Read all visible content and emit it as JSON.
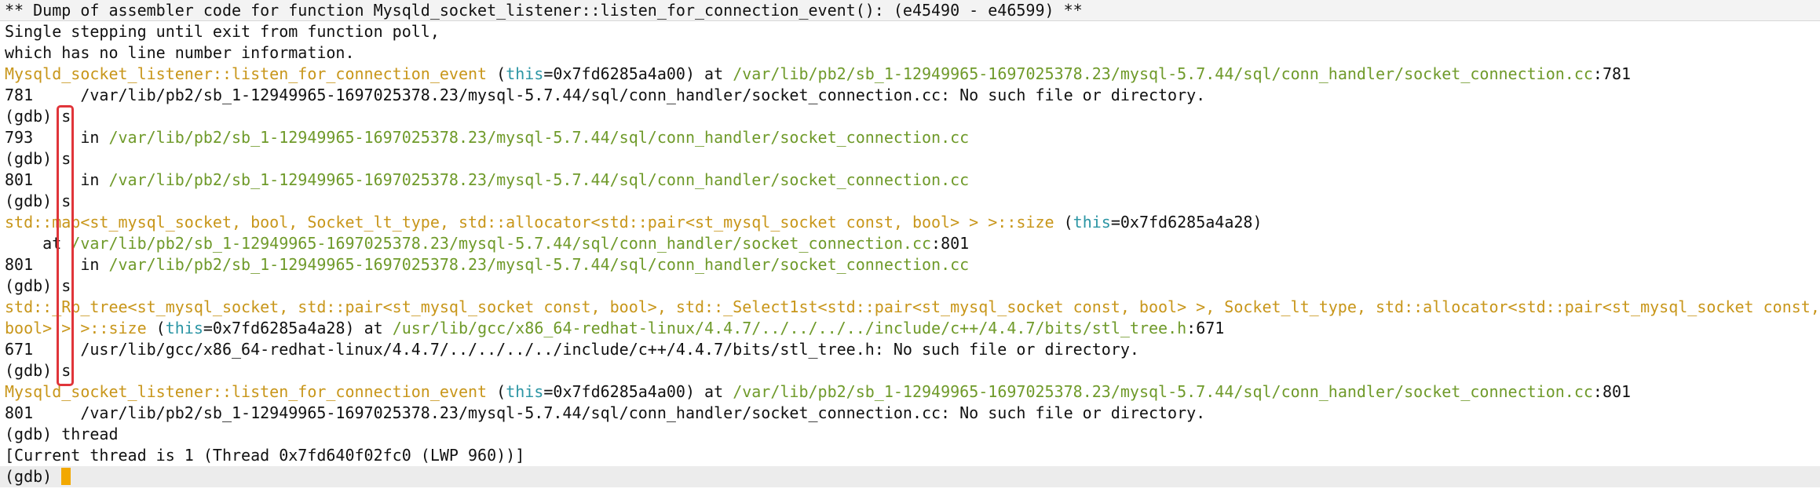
{
  "terminal": {
    "lines": [
      {
        "style": "header",
        "segments": [
          {
            "t": "** Dump of assembler code for function Mysqld_socket_listener::listen_for_connection_event(): (e45490 - e46599) **",
            "c": ""
          }
        ]
      },
      {
        "segments": [
          {
            "t": "Single stepping until exit from function poll,",
            "c": ""
          }
        ]
      },
      {
        "segments": [
          {
            "t": "which has no line number information.",
            "c": ""
          }
        ]
      },
      {
        "segments": [
          {
            "t": "Mysqld_socket_listener::listen_for_connection_event",
            "c": "fn"
          },
          {
            "t": " (",
            "c": ""
          },
          {
            "t": "this",
            "c": "kw"
          },
          {
            "t": "=0x7fd6285a4a00) at ",
            "c": ""
          },
          {
            "t": "/var/lib/pb2/sb_1-12949965-1697025378.23/mysql-5.7.44/sql/conn_handler/socket_connection.cc",
            "c": "path"
          },
          {
            "t": ":781",
            "c": ""
          }
        ]
      },
      {
        "segments": [
          {
            "t": "781     /var/lib/pb2/sb_1-12949965-1697025378.23/mysql-5.7.44/sql/conn_handler/socket_connection.cc: No such file or directory.",
            "c": ""
          }
        ]
      },
      {
        "segments": [
          {
            "t": "(gdb) s",
            "c": ""
          }
        ]
      },
      {
        "segments": [
          {
            "t": "793     in ",
            "c": ""
          },
          {
            "t": "/var/lib/pb2/sb_1-12949965-1697025378.23/mysql-5.7.44/sql/conn_handler/socket_connection.cc",
            "c": "path"
          }
        ]
      },
      {
        "segments": [
          {
            "t": "(gdb) s",
            "c": ""
          }
        ]
      },
      {
        "segments": [
          {
            "t": "801     in ",
            "c": ""
          },
          {
            "t": "/var/lib/pb2/sb_1-12949965-1697025378.23/mysql-5.7.44/sql/conn_handler/socket_connection.cc",
            "c": "path"
          }
        ]
      },
      {
        "segments": [
          {
            "t": "(gdb) s",
            "c": ""
          }
        ]
      },
      {
        "segments": [
          {
            "t": "std::map<st_mysql_socket, bool, Socket_lt_type, std::allocator<std::pair<st_mysql_socket const, bool> > >::size",
            "c": "fn"
          },
          {
            "t": " (",
            "c": ""
          },
          {
            "t": "this",
            "c": "kw"
          },
          {
            "t": "=0x7fd6285a4a28)",
            "c": ""
          }
        ]
      },
      {
        "segments": [
          {
            "t": "    at ",
            "c": ""
          },
          {
            "t": "/var/lib/pb2/sb_1-12949965-1697025378.23/mysql-5.7.44/sql/conn_handler/socket_connection.cc",
            "c": "path"
          },
          {
            "t": ":801",
            "c": ""
          }
        ]
      },
      {
        "segments": [
          {
            "t": "801     in ",
            "c": ""
          },
          {
            "t": "/var/lib/pb2/sb_1-12949965-1697025378.23/mysql-5.7.44/sql/conn_handler/socket_connection.cc",
            "c": "path"
          }
        ]
      },
      {
        "segments": [
          {
            "t": "(gdb) s",
            "c": ""
          }
        ]
      },
      {
        "segments": [
          {
            "t": "std::_Rb_tree<st_mysql_socket, std::pair<st_mysql_socket const, bool>, std::_Select1st<std::pair<st_mysql_socket const, bool> >, Socket_lt_type, std::allocator<std::pair<st_mysql_socket const,",
            "c": "fn"
          }
        ]
      },
      {
        "segments": [
          {
            "t": "bool> > >::size",
            "c": "fn"
          },
          {
            "t": " (",
            "c": ""
          },
          {
            "t": "this",
            "c": "kw"
          },
          {
            "t": "=0x7fd6285a4a28) at ",
            "c": ""
          },
          {
            "t": "/usr/lib/gcc/x86_64-redhat-linux/4.4.7/../../../../include/c++/4.4.7/bits/stl_tree.h",
            "c": "path"
          },
          {
            "t": ":671",
            "c": ""
          }
        ]
      },
      {
        "segments": [
          {
            "t": "671     /usr/lib/gcc/x86_64-redhat-linux/4.4.7/../../../../include/c++/4.4.7/bits/stl_tree.h: No such file or directory.",
            "c": ""
          }
        ]
      },
      {
        "segments": [
          {
            "t": "(gdb) s",
            "c": ""
          }
        ]
      },
      {
        "segments": [
          {
            "t": "Mysqld_socket_listener::listen_for_connection_event",
            "c": "fn"
          },
          {
            "t": " (",
            "c": ""
          },
          {
            "t": "this",
            "c": "kw"
          },
          {
            "t": "=0x7fd6285a4a00) at ",
            "c": ""
          },
          {
            "t": "/var/lib/pb2/sb_1-12949965-1697025378.23/mysql-5.7.44/sql/conn_handler/socket_connection.cc",
            "c": "path"
          },
          {
            "t": ":801",
            "c": ""
          }
        ]
      },
      {
        "segments": [
          {
            "t": "801     /var/lib/pb2/sb_1-12949965-1697025378.23/mysql-5.7.44/sql/conn_handler/socket_connection.cc: No such file or directory.",
            "c": ""
          }
        ]
      },
      {
        "segments": [
          {
            "t": "(gdb) thread",
            "c": ""
          }
        ]
      },
      {
        "segments": [
          {
            "t": "[Current thread is 1 (Thread 0x7fd640f02fc0 (LWP 960))]",
            "c": ""
          }
        ]
      },
      {
        "style": "current",
        "segments": [
          {
            "t": "(gdb) ",
            "c": ""
          }
        ],
        "cursor": true
      }
    ]
  },
  "colors": {
    "function_name": "#c8961a",
    "path": "#6f9a2a",
    "keyword": "#2b95a4",
    "cursor": "#f2a800",
    "highlight_box": "#e0353a"
  }
}
